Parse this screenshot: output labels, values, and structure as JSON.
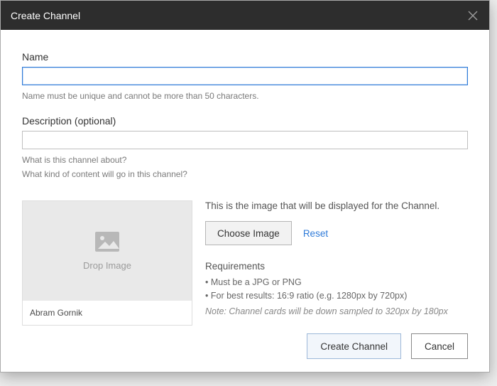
{
  "dialog": {
    "title": "Create Channel"
  },
  "name": {
    "label": "Name",
    "value": "",
    "hint": "Name must be unique and cannot be more than 50 characters."
  },
  "description": {
    "label": "Description (optional)",
    "value": "",
    "hint1": "What is this channel about?",
    "hint2": "What kind of content will go in this channel?"
  },
  "image": {
    "drop_label": "Drop Image",
    "card_owner": "Abram Gornik",
    "lead": "This is the image that will be displayed for the Channel.",
    "choose_label": "Choose Image",
    "reset_label": "Reset",
    "requirements_title": "Requirements",
    "req1": "Must be a JPG or PNG",
    "req2": "For best results: 16:9 ratio (e.g. 1280px by 720px)",
    "note": "Note: Channel cards will be down sampled to 320px by 180px"
  },
  "footer": {
    "create_label": "Create Channel",
    "cancel_label": "Cancel"
  }
}
